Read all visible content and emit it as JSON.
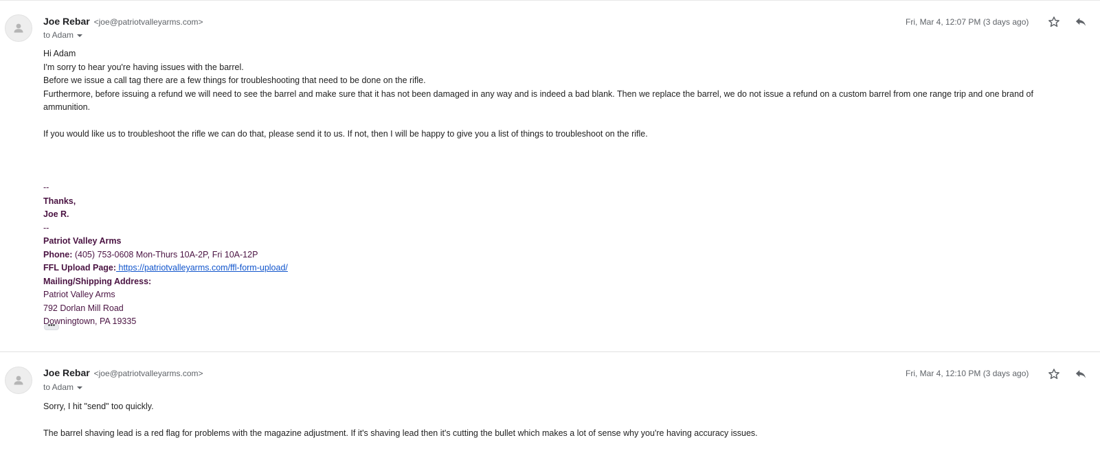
{
  "messages": [
    {
      "sender_name": "Joe Rebar",
      "sender_email": "<joe@patriotvalleyarms.com>",
      "to": "to Adam",
      "date": "Fri, Mar 4, 12:07 PM (3 days ago)",
      "body": [
        "Hi Adam",
        "I'm sorry to hear you're having issues with the barrel.",
        "Before we issue a call tag there are a few things for troubleshooting that need to be done on the rifle.",
        "Furthermore, before issuing a refund we will need to see the barrel and make sure that it has not been damaged in any way and is indeed a bad blank. Then we replace the barrel, we do not issue a refund on a custom barrel from one range trip and one brand of ammunition.",
        "If you would like us to troubleshoot the rifle we can do that, please send it to us.  If not, then I will be happy to give you a list of things to troubleshoot on the rifle."
      ],
      "signature": {
        "dash1": "--",
        "thanks": "Thanks,",
        "name": "Joe R.",
        "dash2": "--",
        "company": "Patriot Valley Arms",
        "phone_label": "Phone:",
        "phone_value": " (405) 753-0608 Mon-Thurs 10A-2P, Fri 10A-12P",
        "ffl_label": "FFL Upload Page:",
        "ffl_link": " https://patriotvalleyarms.com/ffl-form-upload/ ",
        "address_label": "Mailing/Shipping Address:",
        "address_lines": [
          "Patriot Valley Arms",
          "792 Dorlan Mill Road",
          "Downingtown, PA 19335"
        ]
      },
      "show_trimmed_label": "•••"
    },
    {
      "sender_name": "Joe Rebar",
      "sender_email": "<joe@patriotvalleyarms.com>",
      "to": "to Adam",
      "date": "Fri, Mar 4, 12:10 PM (3 days ago)",
      "body": [
        "Sorry, I hit \"send\" too quickly.",
        "The barrel shaving lead is a red flag for problems with the magazine adjustment. If it's shaving lead then it's cutting the bullet which makes a lot of sense why you're having accuracy issues."
      ]
    }
  ],
  "icons": {
    "avatar": "person-icon",
    "star": "star-icon",
    "reply": "reply-icon",
    "more": "chevron-down-icon"
  },
  "colors": {
    "signature": "#4a1342",
    "link": "#1155cc",
    "meta": "#5f6368"
  }
}
